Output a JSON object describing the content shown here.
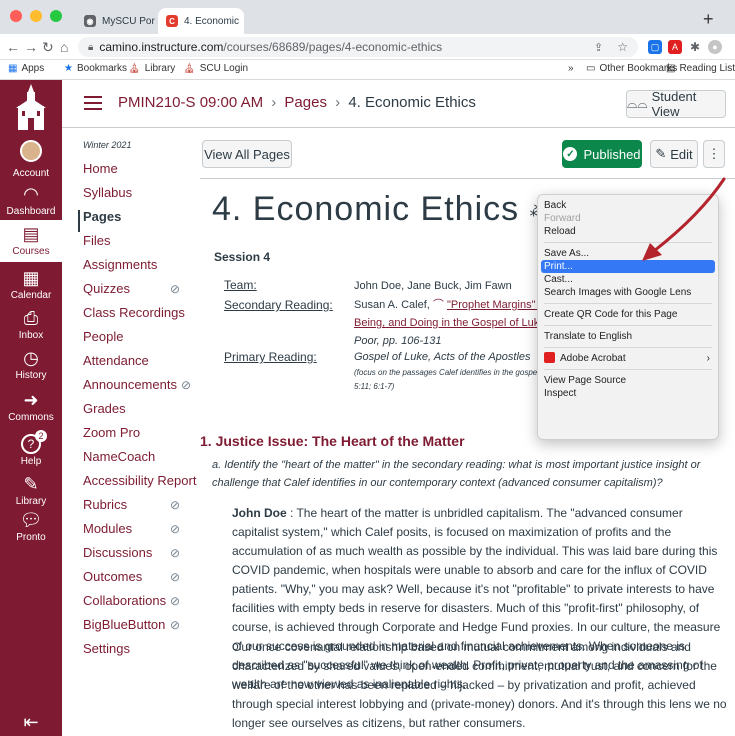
{
  "browser": {
    "tabs": [
      {
        "title": "MySCU Por",
        "icon": "globe-icon"
      },
      {
        "title": "4. Economic",
        "icon": "canvas-icon"
      }
    ],
    "url_host": "camino.instructure.com",
    "url_path": "/courses/68689/pages/4-economic-ethics",
    "bookmarks": {
      "apps": "Apps",
      "bookmarks": "Bookmarks",
      "library": "Library",
      "scu_login": "SCU Login",
      "chevron": "»",
      "other": "Other Bookmarks",
      "reading": "Reading List"
    }
  },
  "global_nav": [
    {
      "label": "Account",
      "icon": "avatar-icon"
    },
    {
      "label": "Dashboard",
      "icon": "dashboard-icon"
    },
    {
      "label": "Courses",
      "icon": "courses-icon"
    },
    {
      "label": "Calendar",
      "icon": "calendar-icon"
    },
    {
      "label": "Inbox",
      "icon": "inbox-icon"
    },
    {
      "label": "History",
      "icon": "history-icon"
    },
    {
      "label": "Commons",
      "icon": "commons-icon"
    },
    {
      "label": "Help",
      "icon": "help-icon",
      "badge": "2"
    },
    {
      "label": "Library",
      "icon": "library-icon"
    },
    {
      "label": "Pronto",
      "icon": "pronto-icon"
    }
  ],
  "header": {
    "course": "PMIN210-S 09:00 AM",
    "sep": "›",
    "pages": "Pages",
    "current": "4. Economic Ethics",
    "student_view": "Student View"
  },
  "course_nav": {
    "term": "Winter 2021",
    "items": [
      {
        "label": "Home",
        "hidden": false
      },
      {
        "label": "Syllabus",
        "hidden": false
      },
      {
        "label": "Pages",
        "hidden": false,
        "active": true
      },
      {
        "label": "Files",
        "hidden": false
      },
      {
        "label": "Assignments",
        "hidden": false
      },
      {
        "label": "Quizzes",
        "hidden": true
      },
      {
        "label": "Class Recordings",
        "hidden": false
      },
      {
        "label": "People",
        "hidden": false
      },
      {
        "label": "Attendance",
        "hidden": false
      },
      {
        "label": "Announcements",
        "hidden": true
      },
      {
        "label": "Grades",
        "hidden": false
      },
      {
        "label": "Zoom Pro",
        "hidden": false
      },
      {
        "label": "NameCoach",
        "hidden": false
      },
      {
        "label": "Accessibility Report",
        "hidden": false
      },
      {
        "label": "Rubrics",
        "hidden": true
      },
      {
        "label": "Modules",
        "hidden": true
      },
      {
        "label": "Discussions",
        "hidden": true
      },
      {
        "label": "Outcomes",
        "hidden": true
      },
      {
        "label": "Collaborations",
        "hidden": true
      },
      {
        "label": "BigBlueButton",
        "hidden": true
      },
      {
        "label": "Settings",
        "hidden": false
      }
    ]
  },
  "toolbar": {
    "view_all": "View All Pages",
    "published": "Published",
    "edit": "Edit",
    "more": "⋮"
  },
  "page": {
    "title": "4. Economic Ethics",
    "session": "Session 4",
    "team_label": "Team:",
    "team_value": "John Doe, Jane Buck, Jim Fawn",
    "secondary_label": "Secondary Reading:",
    "secondary_author": "Susan A. Calef,",
    "secondary_link": "\"Prophet Margins\" in",
    "secondary_link2": "Being, and Doing in the Gospel of Luke",
    "secondary_tail": "Poor, pp. 106-131",
    "primary_label": "Primary Reading:",
    "primary_value": "Gospel of Luke, Acts of the Apostles",
    "primary_note": "(focus on the passages Calef identifies in the gospel",
    "primary_note2": "5:11; 6:1-7)",
    "section_heading": "1. Justice Issue: The Heart of the Matter",
    "question": "a. Identify the \"heart of the matter\" in the secondary reading: what is most important justice insight or challenge that Calef identifies in our contemporary context (advanced consumer capitalism)?",
    "answer_name": "John Doe",
    "answer_p1": " :  The heart of the matter is unbridled capitalism.  The \"advanced consumer capitalist system,\" which Calef posits, is focused on maximization of profits and the accumulation of as much wealth as possible by the individual.  This was laid bare during this COVID pandemic, when hospitals were unable to absorb and care for the influx of COVID patients.  \"Why,\" you may ask?  Well, because it's not \"profitable\" to private interests to have facilities with empty beds in reserve for disasters.  Much of this \"profit-first\" philosophy, of course, is achieved through Corporate and Hedge Fund proxies.  In our culture, the measure of our success is grounded in material and financial achievements.  When someone is described as \"successful\" we think of wealth.  Profit, private property and the amassing of wealth are now viewed as inalienable rights.",
    "answer_p2": "Our once covenantal relationship based on mutual commitment among individuals and characterized by shared values, open-ended commitment, mutual trust, and concern for the welfare of the other has been replaced – hijacked – by privatization and profit, achieved through special interest lobbying and (private-money) donors.  And it's through this lens we no longer see ourselves as citizens, but rather consumers."
  },
  "context_menu": {
    "back": "Back",
    "forward": "Forward",
    "reload": "Reload",
    "save_as": "Save As...",
    "print": "Print...",
    "cast": "Cast...",
    "search_images": "Search Images with Google Lens",
    "qr": "Create QR Code for this Page",
    "translate": "Translate to English",
    "acrobat": "Adobe Acrobat",
    "view_source": "View Page Source",
    "inspect": "Inspect"
  },
  "colors": {
    "brand": "#7e1b32",
    "published": "#0b874b",
    "menu_highlight": "#3478f6",
    "annotation_arrow": "#b3242d"
  }
}
